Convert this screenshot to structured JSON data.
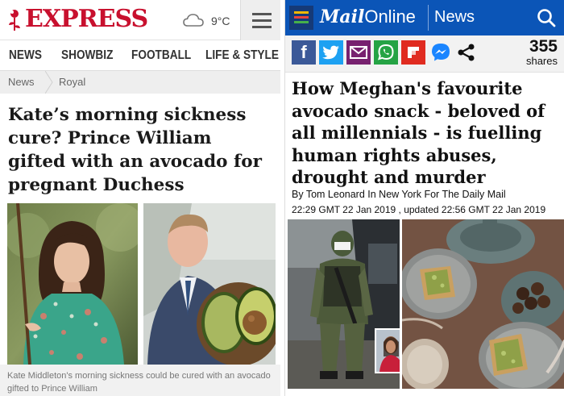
{
  "express": {
    "logo": "EXPRESS",
    "temperature": "9°C",
    "nav": [
      "NEWS",
      "SHOWBIZ",
      "FOOTBALL",
      "LIFE & STYLE"
    ],
    "breadcrumb": [
      "News",
      "Royal"
    ],
    "headline": "Kate’s morning sickness cure? Prince William gifted with an avocado for pregnant Duchess",
    "caption": "Kate Middleton's morning sickness could be cured with an avocado gifted to Prince William",
    "icons": [
      "rose-logo-icon",
      "cloud-icon",
      "hamburger-menu-icon"
    ],
    "colors": {
      "brand": "#c8102e"
    }
  },
  "mail": {
    "logo_brand": "Mail",
    "logo_suffix": "Online",
    "section": "News",
    "share_buttons": [
      "facebook-icon",
      "twitter-icon",
      "email-icon",
      "whatsapp-icon",
      "flipboard-icon",
      "messenger-icon",
      "share-icon"
    ],
    "share_count": "355",
    "share_label": "shares",
    "headline": "How Meghan's favourite avocado snack - beloved of all millennials - is fuelling human rights abuses, drought and murder",
    "byline": "By Tom Leonard In New York For The Daily Mail",
    "dates": "22:29 GMT 22 Jan 2019 , updated 22:56 GMT 22 Jan 2019",
    "colors": {
      "brand": "#0b55b7"
    }
  }
}
